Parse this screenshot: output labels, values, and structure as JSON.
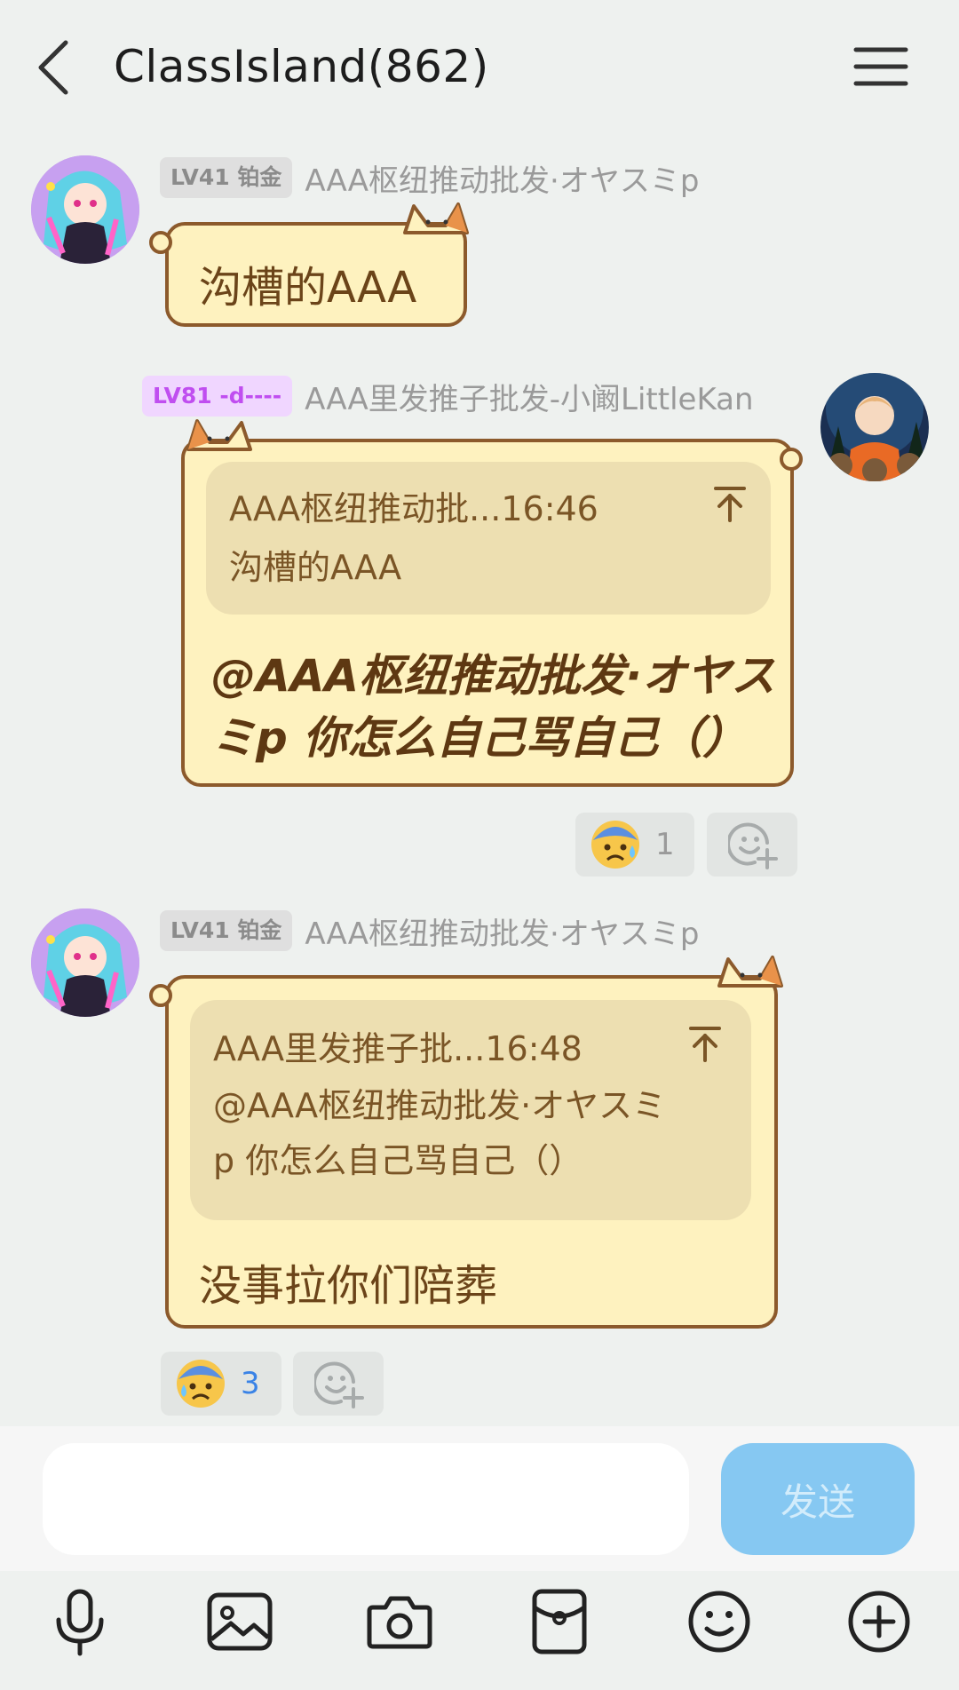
{
  "header": {
    "title": "ClassIsland(862)"
  },
  "messages": [
    {
      "side": "left",
      "level": "LV41 铂金",
      "nickname": "AAA枢纽推动批发·オヤスミp",
      "text": "沟槽的AAA"
    },
    {
      "side": "right",
      "level": "LV81 -d----",
      "nickname": "AAA里发推子批发-小阚LittleKan",
      "quote": {
        "head": "AAA枢纽推动批...16:46",
        "body": "沟槽的AAA"
      },
      "text_lines": [
        "@AAA枢纽推动批发·オヤス",
        "ミp 你怎么自己骂自己（）"
      ],
      "reaction": {
        "emoji": "anxious-face-with-sweat",
        "count": "1"
      }
    },
    {
      "side": "left",
      "level": "LV41 铂金",
      "nickname": "AAA枢纽推动批发·オヤスミp",
      "quote": {
        "head": "AAA里发推子批...16:48",
        "body_lines": [
          "@AAA枢纽推动批发·オヤスミ",
          "p 你怎么自己骂自己（）"
        ]
      },
      "text": "没事拉你们陪葬",
      "reaction": {
        "emoji": "anxious-face-with-sweat",
        "count": "3"
      }
    }
  ],
  "composer": {
    "input_value": "",
    "send_label": "发送"
  },
  "toolbar": [
    "microphone-icon",
    "image-icon",
    "camera-icon",
    "red-packet-icon",
    "emoji-icon",
    "plus-icon"
  ]
}
